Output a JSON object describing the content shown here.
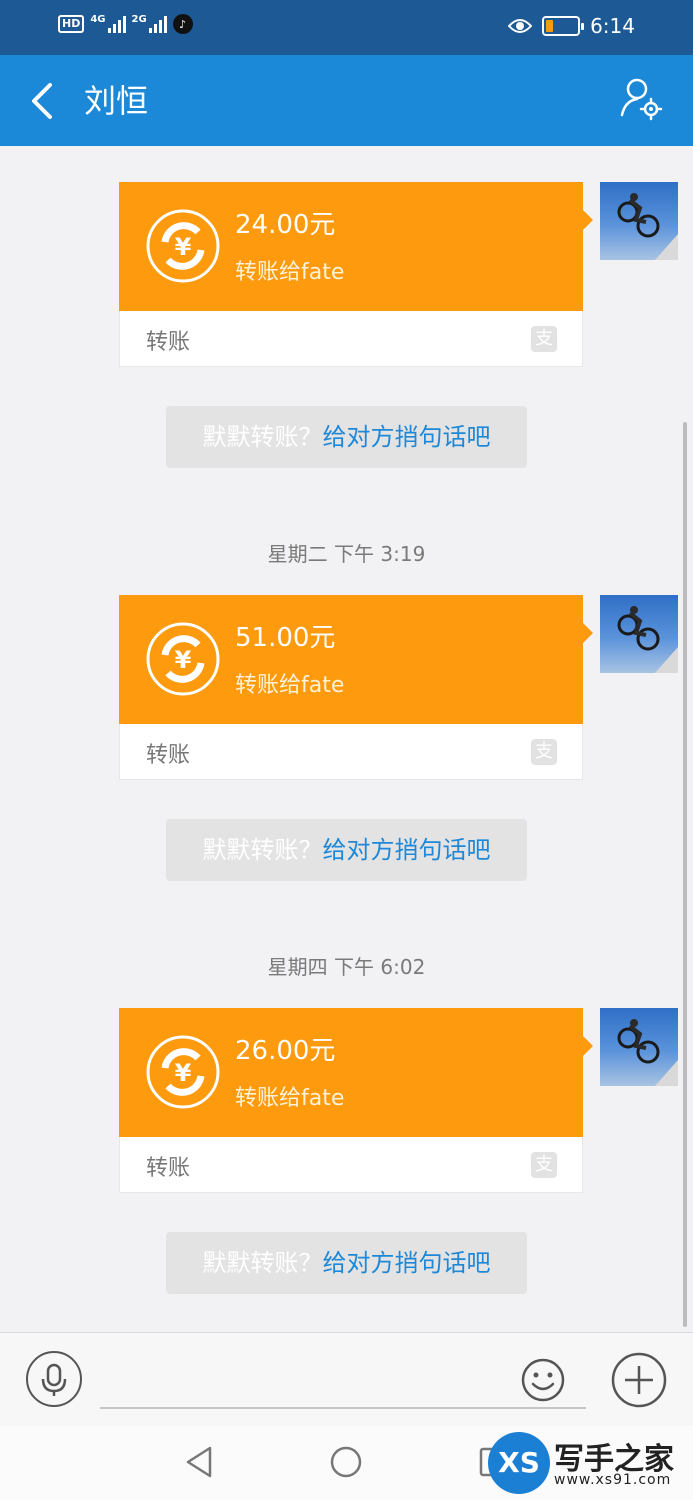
{
  "status_bar": {
    "hd_label": "HD",
    "network1": "4G",
    "network2": "2G",
    "time": "6:14",
    "battery_color": "#f39c12"
  },
  "header": {
    "title": "刘恒",
    "back_icon": "chevron-left-icon",
    "profile_icon": "user-settings-icon",
    "color": "#1b88d8"
  },
  "messages": [
    {
      "amount": "24.00元",
      "recipient": "转账给fate",
      "type_label": "转账",
      "prompt_gray": "默默转账？",
      "prompt_link": "给对方捎句话吧"
    },
    {
      "timestamp": "星期二 下午 3:19",
      "amount": "51.00元",
      "recipient": "转账给fate",
      "type_label": "转账",
      "prompt_gray": "默默转账？",
      "prompt_link": "给对方捎句话吧"
    },
    {
      "timestamp": "星期四 下午 6:02",
      "amount": "26.00元",
      "recipient": "转账给fate",
      "type_label": "转账",
      "prompt_gray": "默默转账？",
      "prompt_link": "给对方捎句话吧"
    }
  ],
  "card_colors": {
    "orange": "#fd9a0d",
    "link": "#1e88d8"
  },
  "input_bar": {
    "voice_icon": "microphone-icon",
    "emoji_icon": "smiley-icon",
    "more_icon": "plus-circle-icon",
    "placeholder": ""
  },
  "nav_bar": {
    "back_icon": "triangle-back-icon",
    "home_icon": "circle-home-icon",
    "recent_icon": "square-recent-icon"
  },
  "watermark": {
    "badge": "XS",
    "title": "写手之家",
    "url": "www.xs91.com"
  }
}
